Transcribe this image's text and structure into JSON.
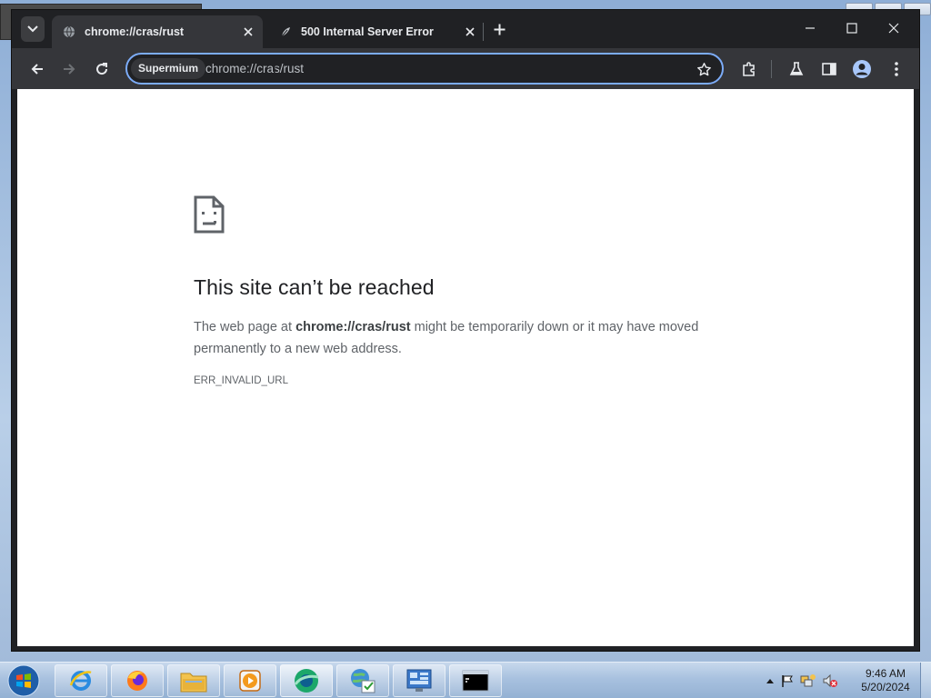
{
  "browser": {
    "tabs": [
      {
        "title": "chrome://cras/rust",
        "active": true,
        "icon": "globe-icon"
      },
      {
        "title": "500 Internal Server Error",
        "active": false,
        "icon": "feather-icon"
      }
    ],
    "omnibox": {
      "chip_label": "Supermium",
      "url": "chrome://cras/rust"
    }
  },
  "error_page": {
    "title": "This site can’t be reached",
    "desc_prefix": "The web page at ",
    "desc_url": "chrome://cras/rust",
    "desc_suffix": " might be temporarily down or it may have moved permanently to a new web address.",
    "code": "ERR_INVALID_URL"
  },
  "taskbar": {
    "items": [
      "internet-explorer-icon",
      "firefox-icon",
      "file-explorer-icon",
      "media-player-icon",
      "supermium-icon",
      "network-globe-icon",
      "control-panel-icon",
      "command-prompt-icon"
    ],
    "clock_time": "9:46 AM",
    "clock_date": "5/20/2024"
  },
  "colors": {
    "accent": "#7cacf8",
    "tab_active": "#35363a",
    "chrome_dark": "#202124"
  }
}
